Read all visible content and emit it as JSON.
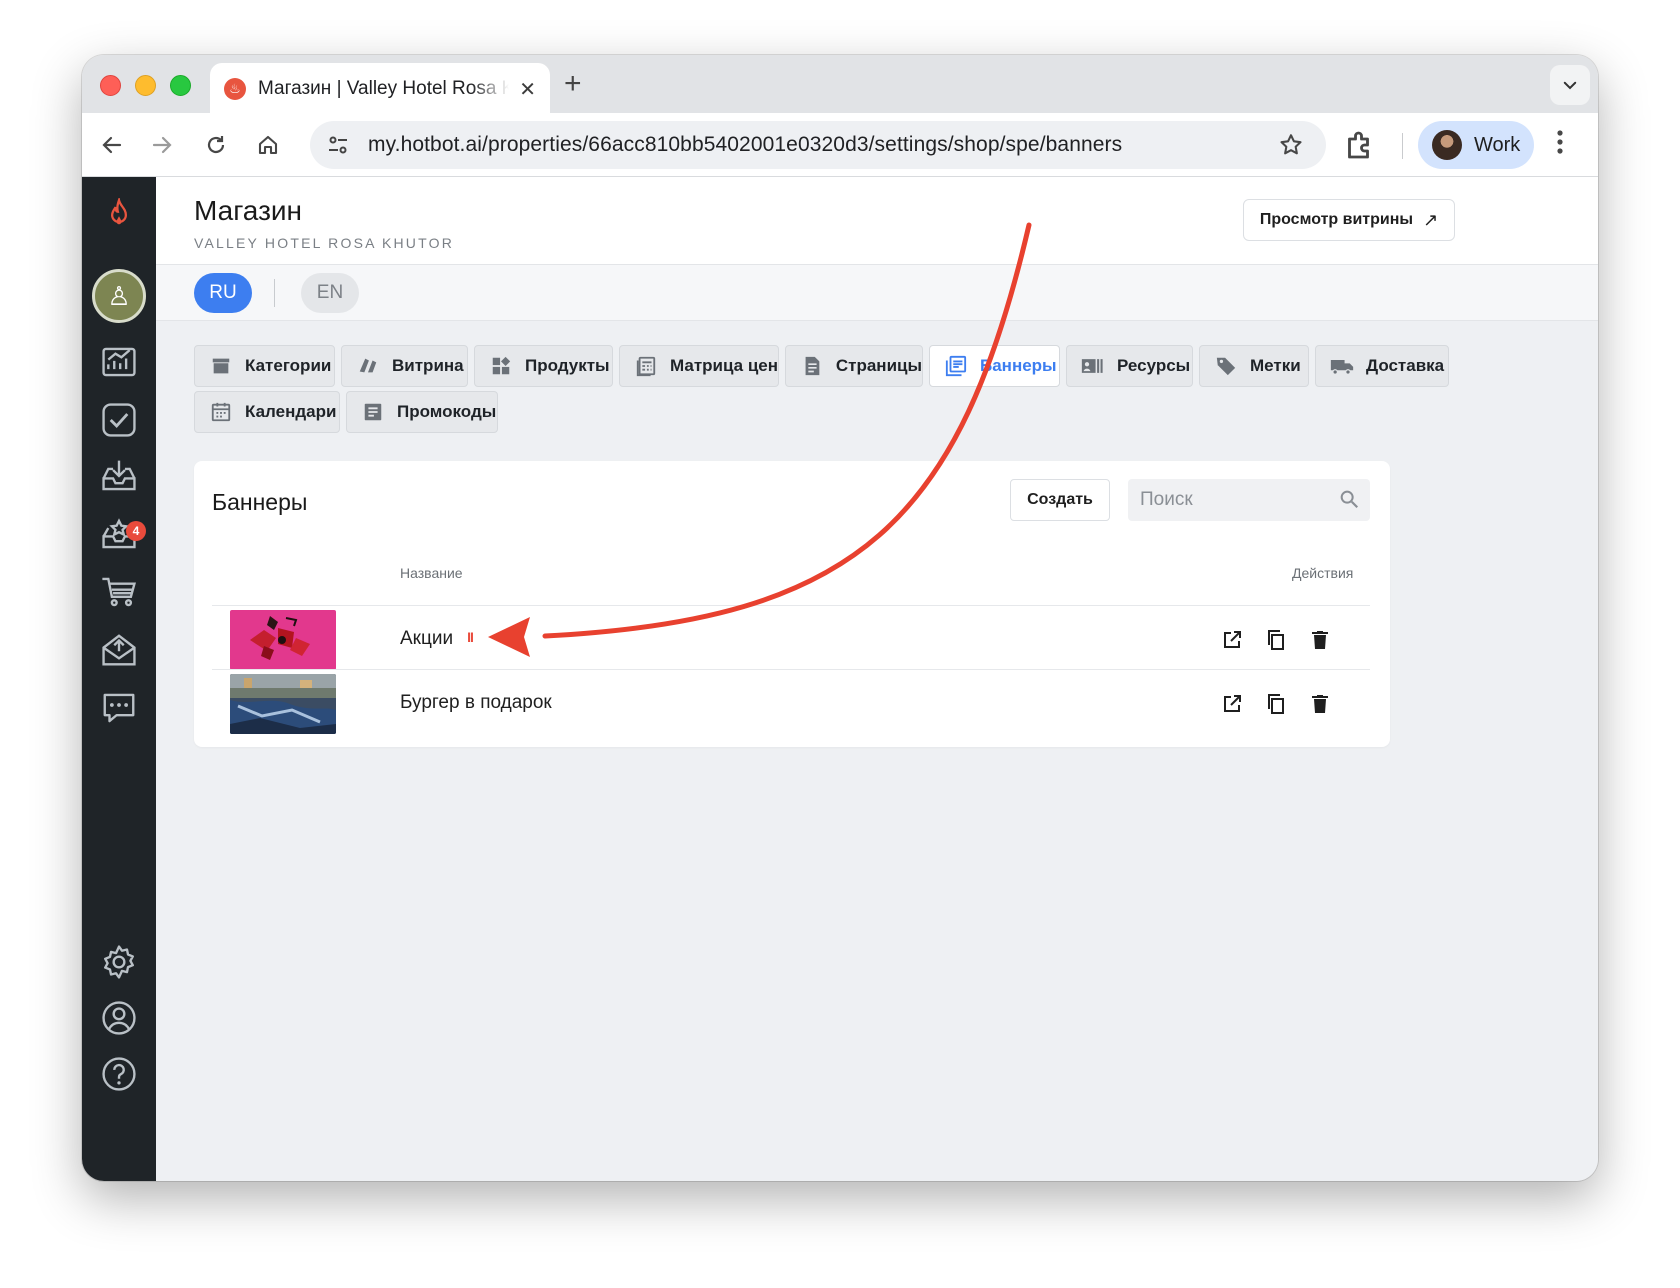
{
  "browser": {
    "tab_title": "Магазин | Valley Hotel Rosa Khutor",
    "new_tab": "+",
    "url": "my.hotbot.ai/properties/66acc810bb5402001e0320d3/settings/shop/spe/banners",
    "profile_name": "Work"
  },
  "sidebar": {
    "notification_count": "4",
    "items": [
      "flame-logo-icon",
      "user-avatar",
      "analytics-icon",
      "tasks-icon",
      "inbox-download-icon",
      "reviews-icon",
      "cart-icon",
      "mail-send-icon",
      "chat-icon",
      "settings-icon",
      "account-icon",
      "help-icon"
    ]
  },
  "header": {
    "title": "Магазин",
    "subtitle": "VALLEY HOTEL ROSA KHUTOR",
    "preview_button": "Просмотр витрины",
    "preview_arrow": "↗"
  },
  "languages": {
    "ru": "RU",
    "en": "EN",
    "active": "RU"
  },
  "shop_tabs": [
    {
      "label": "Категории",
      "icon": "store-icon"
    },
    {
      "label": "Витрина",
      "icon": "showcase-icon"
    },
    {
      "label": "Продукты",
      "icon": "products-icon"
    },
    {
      "label": "Матрица цен",
      "icon": "price-matrix-icon"
    },
    {
      "label": "Страницы",
      "icon": "pages-icon"
    },
    {
      "label": "Баннеры",
      "icon": "banners-icon",
      "active": true
    },
    {
      "label": "Ресурсы",
      "icon": "resources-icon"
    },
    {
      "label": "Метки",
      "icon": "tags-icon"
    },
    {
      "label": "Доставка",
      "icon": "delivery-icon"
    },
    {
      "label": "Календари",
      "icon": "calendar-icon"
    },
    {
      "label": "Промокоды",
      "icon": "promocodes-icon"
    }
  ],
  "banners": {
    "title": "Баннеры",
    "create_button": "Создать",
    "search_placeholder": "Поиск",
    "columns": {
      "name": "Название",
      "actions": "Действия"
    },
    "rows": [
      {
        "name": "Акции",
        "status": "paused",
        "status_glyph": "II"
      },
      {
        "name": "Бургер в подарок",
        "status": "active"
      }
    ]
  },
  "colors": {
    "accent": "#3d7ef0",
    "annotation_arrow": "#e8412f",
    "sidebar": "#1f2428"
  }
}
